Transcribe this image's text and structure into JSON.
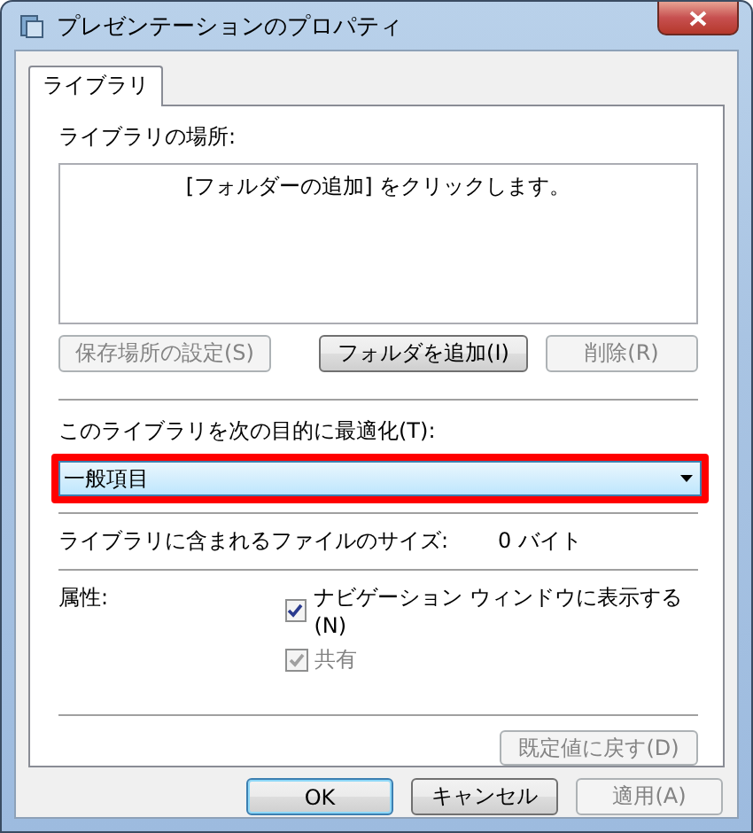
{
  "window": {
    "title": "プレゼンテーションのプロパティ"
  },
  "tabs": [
    {
      "label": "ライブラリ",
      "selected": true
    }
  ],
  "location": {
    "label": "ライブラリの場所:",
    "list_hint": "[フォルダーの追加] をクリックします。",
    "buttons": [
      {
        "label": "保存場所の設定(S)",
        "disabled": true
      },
      {
        "label": "フォルダを追加(I)",
        "disabled": false
      },
      {
        "label": "削除(R)",
        "disabled": true
      }
    ]
  },
  "optimize": {
    "label": "このライブラリを次の目的に最適化(T):",
    "value": "一般項目",
    "highlighted": true
  },
  "size": {
    "label": "ライブラリに含まれるファイルのサイズ:",
    "value": "0 バイト"
  },
  "attributes": {
    "label": "属性:",
    "options": [
      {
        "label": "ナビゲーション ウィンドウに表示する(N)",
        "checked": true,
        "disabled": false
      },
      {
        "label": "共有",
        "checked": true,
        "disabled": true
      }
    ]
  },
  "restore_button": {
    "label": "既定値に戻す(D)",
    "disabled": true
  },
  "buttons": [
    {
      "label": "OK",
      "disabled": false,
      "default": true
    },
    {
      "label": "キャンセル",
      "disabled": false,
      "default": false
    },
    {
      "label": "適用(A)",
      "disabled": true,
      "default": false
    }
  ]
}
